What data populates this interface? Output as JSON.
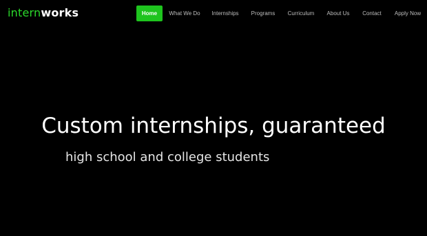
{
  "brand": {
    "logo_accent": "intern",
    "logo_rest": "works",
    "accent_color": "#2bd82b"
  },
  "nav": {
    "items": [
      {
        "label": "Home",
        "active": true
      },
      {
        "label": "What We Do",
        "active": false
      },
      {
        "label": "Internships",
        "active": false
      },
      {
        "label": "Programs",
        "active": false
      },
      {
        "label": "Curriculum",
        "active": false
      },
      {
        "label": "About Us",
        "active": false
      },
      {
        "label": "Contact",
        "active": false
      },
      {
        "label": "Apply Now",
        "active": false
      }
    ],
    "active_color": "#1ec41e"
  },
  "hero": {
    "title": "Custom internships, guaranteed",
    "subtitle": "high school and college students"
  }
}
